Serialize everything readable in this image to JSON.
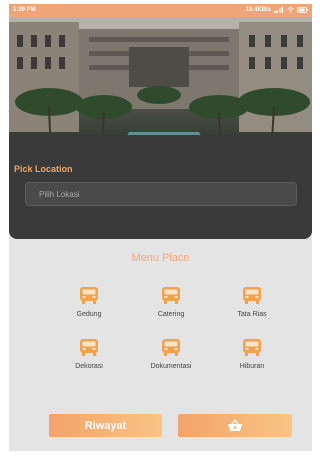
{
  "status_bar": {
    "time": "1:29 PM",
    "network_speed": "18.4KB/s"
  },
  "location": {
    "title": "Pick Location",
    "placeholder": "Pilih Lokasi"
  },
  "menu": {
    "title": "Menu Place",
    "items": [
      {
        "label": "Gedung",
        "icon": "bus-icon"
      },
      {
        "label": "Catering",
        "icon": "bus-icon"
      },
      {
        "label": "Tata Rias",
        "icon": "bus-icon"
      },
      {
        "label": "Dekorasi",
        "icon": "bus-icon"
      },
      {
        "label": "Dokumentasi",
        "icon": "bus-icon"
      },
      {
        "label": "Hiburan",
        "icon": "bus-icon"
      }
    ]
  },
  "buttons": {
    "history_label": "Riwayat",
    "basket_icon": "basket-icon"
  },
  "colors": {
    "accent": "#f4a363",
    "card": "#3a3a3a",
    "background": "#e4e4e4"
  }
}
